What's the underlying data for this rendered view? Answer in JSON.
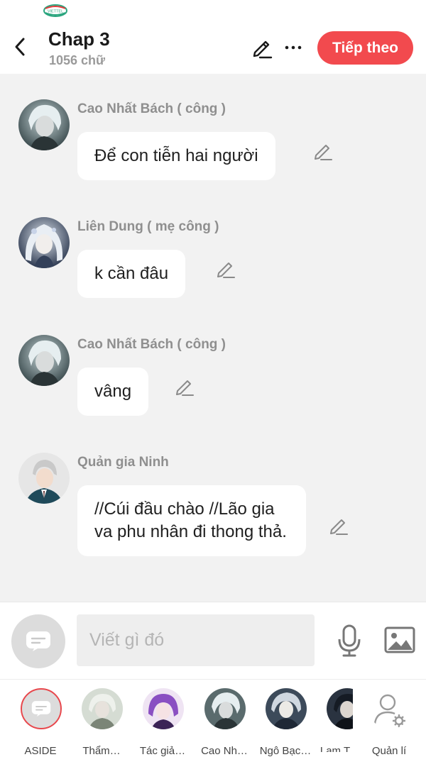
{
  "status_bar": {
    "carrier": "VIETTEL"
  },
  "header": {
    "title": "Chap 3",
    "word_count": "1056 chữ",
    "next_label": "Tiếp theo",
    "accent_color": "#f24a4e"
  },
  "messages": [
    {
      "speaker": "Cao Nhất Bách ( công )",
      "text": "Để con tiễn hai người",
      "avatar": "white-haired-man"
    },
    {
      "speaker": "Liên Dung ( mẹ công )",
      "text": "k cần đâu",
      "avatar": "silver-haired-woman"
    },
    {
      "speaker": "Cao Nhất Bách ( công )",
      "text": "vâng",
      "avatar": "white-haired-man"
    },
    {
      "speaker": "Quản gia Ninh",
      "text": "//Cúi đầu chào //Lão gia va phu nhân đi thong thả.",
      "avatar": "butler-in-suit"
    }
  ],
  "composer": {
    "placeholder": "Viết gì đó",
    "icons": [
      "chat-bubble-icon",
      "microphone-icon",
      "image-icon"
    ]
  },
  "characters": [
    {
      "label": "ASIDE"
    },
    {
      "label": "Thẩm…"
    },
    {
      "label": "Tác giả…"
    },
    {
      "label": "Cao Nh…"
    },
    {
      "label": "Ngô Bạc…"
    },
    {
      "label": "Lam T"
    },
    {
      "label": "Quản lí"
    }
  ]
}
